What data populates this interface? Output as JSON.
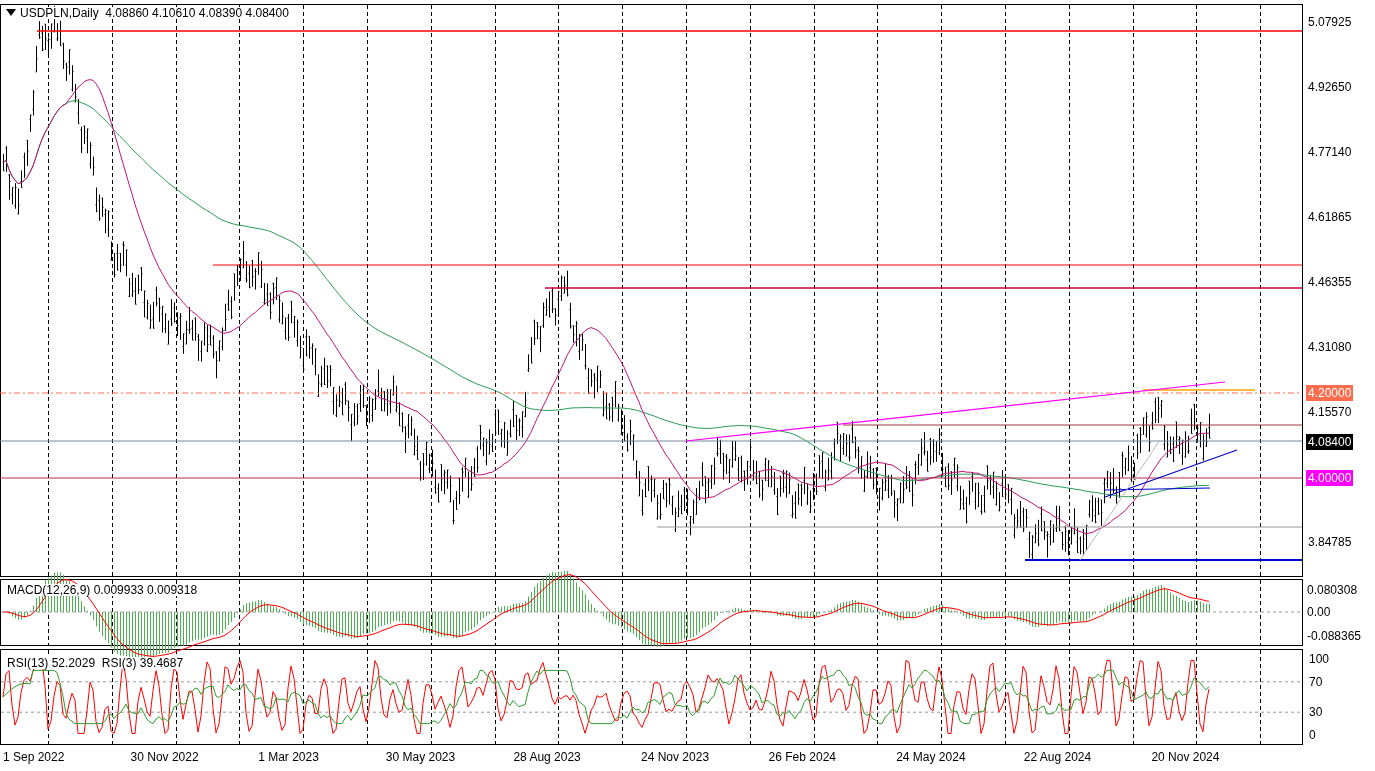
{
  "header": {
    "symbol": "USDPLN,Daily",
    "values": [
      "4.08860",
      "4.10610",
      "4.08390",
      "4.08400"
    ]
  },
  "price_axis": {
    "ticks": [
      "5.07925",
      "4.92650",
      "4.77140",
      "4.61865",
      "4.46355",
      "4.31080",
      "4.15570",
      "3.84785"
    ],
    "markers": [
      {
        "text": "4.20000",
        "color": "#ff6d4d"
      },
      {
        "text": "4.08400",
        "color": "#000000"
      },
      {
        "text": "4.00000",
        "color": "#ff00ff"
      }
    ]
  },
  "macd": {
    "label": "MACD(12,26,9) 0.009933 0.009318",
    "ticks": [
      "0.080308",
      "0.00",
      "-0.088365"
    ]
  },
  "rsi": {
    "label": "RSI(13) 52.2029  RSI(3) 39.4687",
    "ticks": [
      "100",
      "70",
      "30",
      "0"
    ]
  },
  "dates": [
    "1 Sep 2022",
    "30 Nov 2022",
    "1 Mar 2023",
    "30 May 2023",
    "28 Aug 2023",
    "24 Nov 2023",
    "26 Feb 2024",
    "24 May 2024",
    "22 Aug 2024",
    "20 Nov 2024"
  ]
}
